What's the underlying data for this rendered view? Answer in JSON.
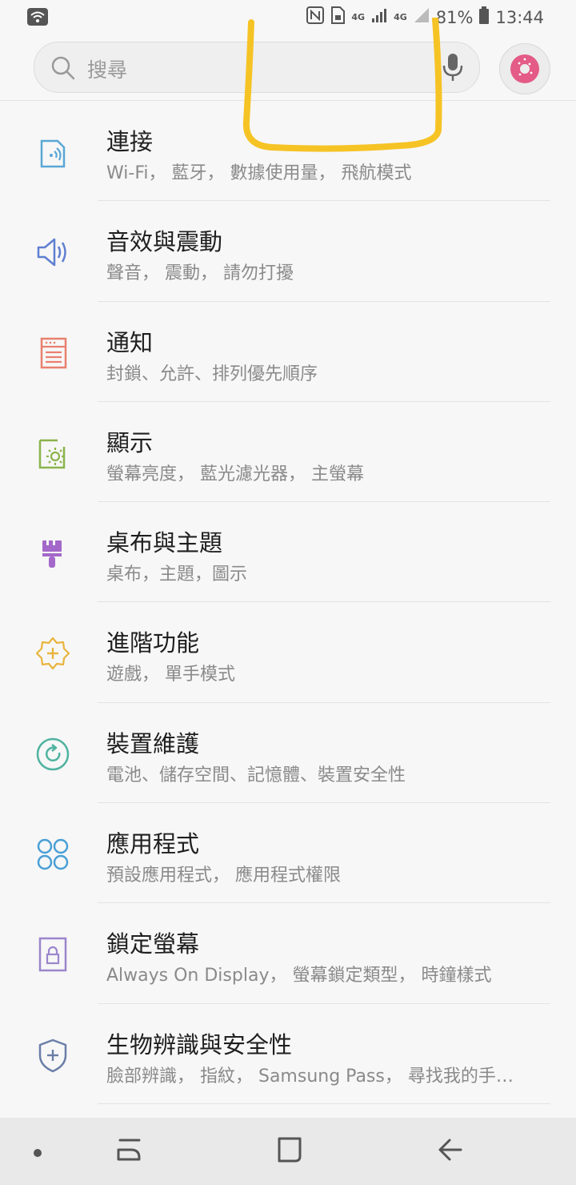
{
  "status_bar": {
    "network_a": "4G",
    "network_b": "4G",
    "battery": "81%",
    "time": "13:44"
  },
  "search": {
    "placeholder": "搜尋"
  },
  "settings": [
    {
      "title": "連接",
      "subtitle": "Wi-Fi， 藍牙， 數據使用量， 飛航模式",
      "icon": "connections-icon",
      "color": "#5aa7d6"
    },
    {
      "title": "音效與震動",
      "subtitle": "聲音， 震動， 請勿打擾",
      "icon": "sound-icon",
      "color": "#5f7fd1"
    },
    {
      "title": "通知",
      "subtitle": "封鎖、允許、排列優先順序",
      "icon": "notifications-icon",
      "color": "#e8806f"
    },
    {
      "title": "顯示",
      "subtitle": "螢幕亮度， 藍光濾光器， 主螢幕",
      "icon": "display-icon",
      "color": "#8bb34c"
    },
    {
      "title": "桌布與主題",
      "subtitle": "桌布，主題，圖示",
      "icon": "brush-icon",
      "color": "#a368c9"
    },
    {
      "title": "進階功能",
      "subtitle": "遊戲， 單手模式",
      "icon": "advanced-features-icon",
      "color": "#e9b43e"
    },
    {
      "title": "裝置維護",
      "subtitle": "電池、儲存空間、記憶體、裝置安全性",
      "icon": "device-maintenance-icon",
      "color": "#4fb3a0"
    },
    {
      "title": "應用程式",
      "subtitle": "預設應用程式， 應用程式權限",
      "icon": "apps-icon",
      "color": "#4a9fd6"
    },
    {
      "title": "鎖定螢幕",
      "subtitle": "Always On Display， 螢幕鎖定類型， 時鐘樣式",
      "icon": "lock-screen-icon",
      "color": "#9b86cc"
    },
    {
      "title": "生物辨識與安全性",
      "subtitle": "臉部辨識， 指紋， Samsung Pass， 尋找我的手…",
      "icon": "shield-icon",
      "color": "#6a7ea8"
    }
  ],
  "colors": {
    "background": "#f7f7f7",
    "annotation": "#f6c325"
  }
}
